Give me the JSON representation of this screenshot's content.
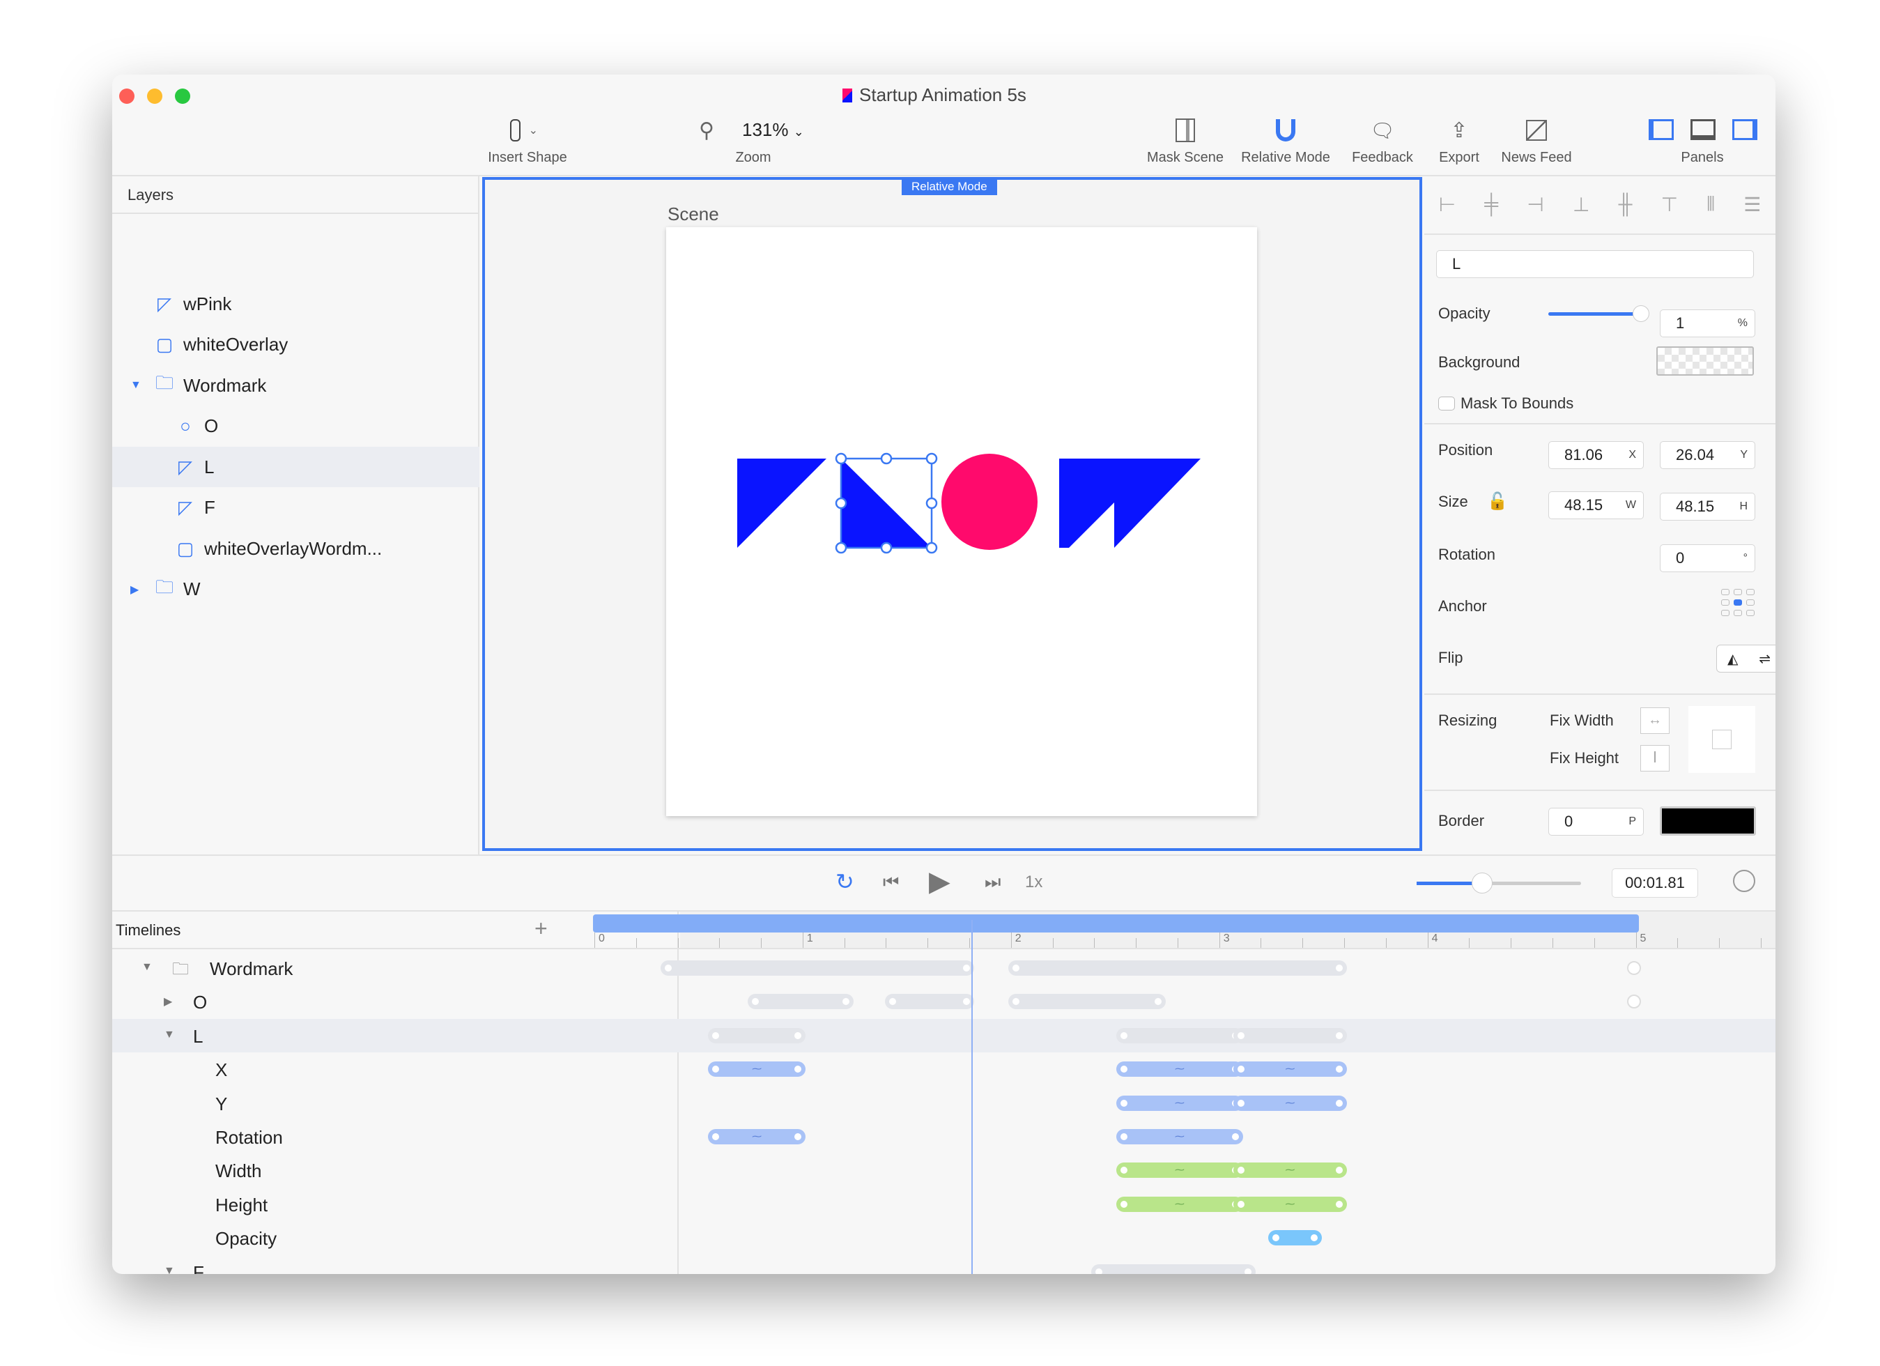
{
  "window": {
    "title": "Startup Animation 5s"
  },
  "toolbar": {
    "insert_shape": "Insert Shape",
    "zoom_value": "131%",
    "zoom_label": "Zoom",
    "mask_scene": "Mask Scene",
    "relative_mode": "Relative Mode",
    "feedback": "Feedback",
    "export": "Export",
    "news_feed": "News Feed",
    "panels": "Panels"
  },
  "layers": {
    "header": "Layers",
    "items": [
      {
        "label": "wPink",
        "icon": "path-icon"
      },
      {
        "label": "whiteOverlay",
        "icon": "rect-icon"
      },
      {
        "label": "Wordmark",
        "icon": "folder-icon",
        "expanded": true
      },
      {
        "label": "O",
        "icon": "circle-icon"
      },
      {
        "label": "L",
        "icon": "path-icon",
        "selected": true
      },
      {
        "label": "F",
        "icon": "path-icon"
      },
      {
        "label": "whiteOverlayWordm...",
        "icon": "rect-icon"
      },
      {
        "label": "W",
        "icon": "folder-icon",
        "expanded": false
      }
    ]
  },
  "canvas": {
    "badge": "Relative Mode",
    "scene_label": "Scene",
    "colors": {
      "blue": "#0a14ff",
      "pink": "#ff0a6c",
      "accent": "#3a78f2"
    }
  },
  "inspector": {
    "name": "L",
    "opacity_label": "Opacity",
    "opacity_value": "1",
    "opacity_unit": "%",
    "opacity_level": 0.95,
    "background_label": "Background",
    "mask_label": "Mask To Bounds",
    "position_label": "Position",
    "x": "81.06",
    "x_unit": "X",
    "y": "26.04",
    "y_unit": "Y",
    "size_label": "Size",
    "w": "48.15",
    "w_unit": "W",
    "h": "48.15",
    "h_unit": "H",
    "rotation_label": "Rotation",
    "rotation": "0",
    "rotation_unit": "°",
    "anchor_label": "Anchor",
    "flip_label": "Flip",
    "resizing_label": "Resizing",
    "fix_width": "Fix Width",
    "fix_height": "Fix Height",
    "border_label": "Border",
    "border_value": "0",
    "border_unit": "P",
    "border_color": "#000000"
  },
  "transport": {
    "speed": "1x",
    "time": "00:01.81",
    "zoom_level": 0.4
  },
  "timeline": {
    "header": "Timelines",
    "add": "+",
    "ticks": [
      "0",
      "1",
      "2",
      "3",
      "4",
      "5"
    ],
    "playhead": 1.81,
    "rows": [
      {
        "label": "Wordmark",
        "indent": 0,
        "arrow": "▼",
        "folder": true,
        "bars": [
          [
            0.35,
            1.79
          ],
          [
            2.02,
            3.58
          ]
        ],
        "dots": [
          4.99
        ],
        "kind": "group"
      },
      {
        "label": "O",
        "indent": 1,
        "arrow": "▶",
        "bars": [
          [
            0.77,
            1.21
          ],
          [
            1.43,
            1.79
          ],
          [
            2.02,
            2.71
          ]
        ],
        "dots": [
          4.99
        ],
        "kind": "group"
      },
      {
        "label": "L",
        "indent": 1,
        "arrow": "▼",
        "bars": [
          [
            0.58,
            0.98
          ],
          [
            2.54,
            3.08
          ],
          [
            3.1,
            3.58
          ]
        ],
        "kind": "group",
        "selected": true
      },
      {
        "label": "X",
        "indent": 2,
        "bars": [
          [
            0.58,
            0.98
          ],
          [
            2.54,
            3.08
          ],
          [
            3.1,
            3.58
          ]
        ],
        "kind": "blue"
      },
      {
        "label": "Y",
        "indent": 2,
        "bars": [
          [
            2.54,
            3.08
          ],
          [
            3.1,
            3.58
          ]
        ],
        "kind": "blue"
      },
      {
        "label": "Rotation",
        "indent": 2,
        "bars": [
          [
            0.58,
            0.98
          ],
          [
            2.54,
            3.08
          ]
        ],
        "kind": "blue"
      },
      {
        "label": "Width",
        "indent": 2,
        "bars": [
          [
            2.54,
            3.08
          ],
          [
            3.1,
            3.58
          ]
        ],
        "kind": "green"
      },
      {
        "label": "Height",
        "indent": 2,
        "bars": [
          [
            2.54,
            3.08
          ],
          [
            3.1,
            3.58
          ]
        ],
        "kind": "green"
      },
      {
        "label": "Opacity",
        "indent": 2,
        "bars": [
          [
            3.27,
            3.46
          ]
        ],
        "kind": "cyan"
      },
      {
        "label": "F",
        "indent": 1,
        "arrow": "▼",
        "bars": [
          [
            2.42,
            3.14
          ]
        ],
        "kind": "group"
      }
    ]
  }
}
